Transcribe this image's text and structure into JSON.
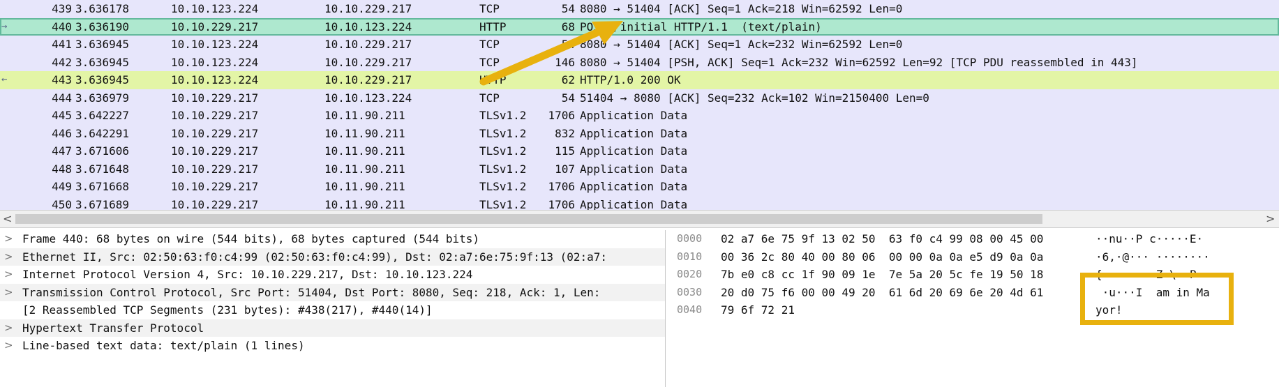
{
  "packets": [
    {
      "no": "439",
      "time": "3.636178",
      "src": "10.10.123.224",
      "dst": "10.10.229.217",
      "proto": "TCP",
      "len": "54",
      "info": "8080 → 51404 [ACK] Seq=1 Ack=218 Win=62592 Len=0",
      "style": "normal",
      "marker": ""
    },
    {
      "no": "440",
      "time": "3.636190",
      "src": "10.10.229.217",
      "dst": "10.10.123.224",
      "proto": "HTTP",
      "len": "68",
      "info": "POST /initial HTTP/1.1  (text/plain)",
      "style": "sel-green",
      "marker": "→"
    },
    {
      "no": "441",
      "time": "3.636945",
      "src": "10.10.123.224",
      "dst": "10.10.229.217",
      "proto": "TCP",
      "len": "54",
      "info": "8080 → 51404 [ACK] Seq=1 Ack=232 Win=62592 Len=0",
      "style": "normal",
      "marker": ""
    },
    {
      "no": "442",
      "time": "3.636945",
      "src": "10.10.123.224",
      "dst": "10.10.229.217",
      "proto": "TCP",
      "len": "146",
      "info": "8080 → 51404 [PSH, ACK] Seq=1 Ack=232 Win=62592 Len=92 [TCP PDU reassembled in 443]",
      "style": "normal",
      "marker": ""
    },
    {
      "no": "443",
      "time": "3.636945",
      "src": "10.10.123.224",
      "dst": "10.10.229.217",
      "proto": "HTTP",
      "len": "62",
      "info": "HTTP/1.0 200 OK",
      "style": "sel-yellow",
      "marker": "←"
    },
    {
      "no": "444",
      "time": "3.636979",
      "src": "10.10.229.217",
      "dst": "10.10.123.224",
      "proto": "TCP",
      "len": "54",
      "info": "51404 → 8080 [ACK] Seq=232 Ack=102 Win=2150400 Len=0",
      "style": "normal",
      "marker": ""
    },
    {
      "no": "445",
      "time": "3.642227",
      "src": "10.10.229.217",
      "dst": "10.11.90.211",
      "proto": "TLSv1.2",
      "len": "1706",
      "info": "Application Data",
      "style": "normal",
      "marker": ""
    },
    {
      "no": "446",
      "time": "3.642291",
      "src": "10.10.229.217",
      "dst": "10.11.90.211",
      "proto": "TLSv1.2",
      "len": "832",
      "info": "Application Data",
      "style": "normal",
      "marker": ""
    },
    {
      "no": "447",
      "time": "3.671606",
      "src": "10.10.229.217",
      "dst": "10.11.90.211",
      "proto": "TLSv1.2",
      "len": "115",
      "info": "Application Data",
      "style": "normal",
      "marker": ""
    },
    {
      "no": "448",
      "time": "3.671648",
      "src": "10.10.229.217",
      "dst": "10.11.90.211",
      "proto": "TLSv1.2",
      "len": "107",
      "info": "Application Data",
      "style": "normal",
      "marker": ""
    },
    {
      "no": "449",
      "time": "3.671668",
      "src": "10.10.229.217",
      "dst": "10.11.90.211",
      "proto": "TLSv1.2",
      "len": "1706",
      "info": "Application Data",
      "style": "normal",
      "marker": ""
    },
    {
      "no": "450",
      "time": "3.671689",
      "src": "10.10.229.217",
      "dst": "10.11.90.211",
      "proto": "TLSv1.2",
      "len": "1706",
      "info": "Application Data",
      "style": "normal",
      "marker": ""
    }
  ],
  "scrollbar": {
    "left_arrow": "<",
    "right_arrow": ">"
  },
  "details": [
    {
      "expander": ">",
      "text": "Frame 440: 68 bytes on wire (544 bits), 68 bytes captured (544 bits)"
    },
    {
      "expander": ">",
      "text": "Ethernet II, Src: 02:50:63:f0:c4:99 (02:50:63:f0:c4:99), Dst: 02:a7:6e:75:9f:13 (02:a7:"
    },
    {
      "expander": ">",
      "text": "Internet Protocol Version 4, Src: 10.10.229.217, Dst: 10.10.123.224"
    },
    {
      "expander": ">",
      "text": "Transmission Control Protocol, Src Port: 51404, Dst Port: 8080, Seq: 218, Ack: 1, Len:"
    },
    {
      "expander": "",
      "text": "[2 Reassembled TCP Segments (231 bytes): #438(217), #440(14)]"
    },
    {
      "expander": ">",
      "text": "Hypertext Transfer Protocol"
    },
    {
      "expander": ">",
      "text": "Line-based text data: text/plain (1 lines)"
    }
  ],
  "bytes": [
    {
      "offset": "0000",
      "hex": "02 a7 6e 75 9f 13 02 50  63 f0 c4 99 08 00 45 00",
      "ascii": "··nu··P c·····E·"
    },
    {
      "offset": "0010",
      "hex": "00 36 2c 80 40 00 80 06  00 00 0a 0a e5 d9 0a 0a",
      "ascii": "·6,·@··· ········"
    },
    {
      "offset": "0020",
      "hex": "7b e0 c8 cc 1f 90 09 1e  7e 5a 20 5c fe 19 50 18",
      "ascii": "{·······~Z \\··P·"
    },
    {
      "offset": "0030",
      "hex": "20 d0 75 f6 00 00 49 20  61 6d 20 69 6e 20 4d 61",
      "ascii": " ·u···I  am in Ma"
    },
    {
      "offset": "0040",
      "hex": "79 6f 72 21",
      "ascii": "yor!"
    }
  ],
  "colors": {
    "list_bg": "#e7e6fb",
    "selected_green": "#aee8cf",
    "selected_yellow": "#e3f5a6",
    "annotation": "#e8b10e"
  }
}
